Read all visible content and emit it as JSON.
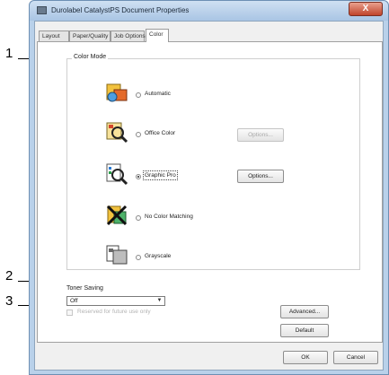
{
  "callouts": [
    {
      "number": "1"
    },
    {
      "number": "2"
    },
    {
      "number": "3"
    }
  ],
  "window": {
    "title": "Durolabel CatalystPS Document Properties",
    "close_label": "X"
  },
  "tabs": [
    "Layout",
    "Paper/Quality",
    "Job Options",
    "Color"
  ],
  "active_tab": "Color",
  "color_mode": {
    "label": "Color Mode",
    "options": [
      {
        "label": "Automatic",
        "selected": false,
        "icon": "auto-color-icon"
      },
      {
        "label": "Office Color",
        "selected": false,
        "icon": "office-color-icon"
      },
      {
        "label": "Graphic Pro",
        "selected": true,
        "icon": "graphic-pro-icon"
      },
      {
        "label": "No Color Matching",
        "selected": false,
        "icon": "no-color-matching-icon"
      },
      {
        "label": "Grayscale",
        "selected": false,
        "icon": "grayscale-icon"
      }
    ],
    "office_options_label": "Options...",
    "graphic_options_label": "Options..."
  },
  "toner_saving": {
    "label": "Toner Saving",
    "value": "Off"
  },
  "disabled_checkbox_label": "Reserved for future use only",
  "buttons": {
    "advanced": "Advanced...",
    "default": "Default",
    "ok": "OK",
    "cancel": "Cancel"
  }
}
